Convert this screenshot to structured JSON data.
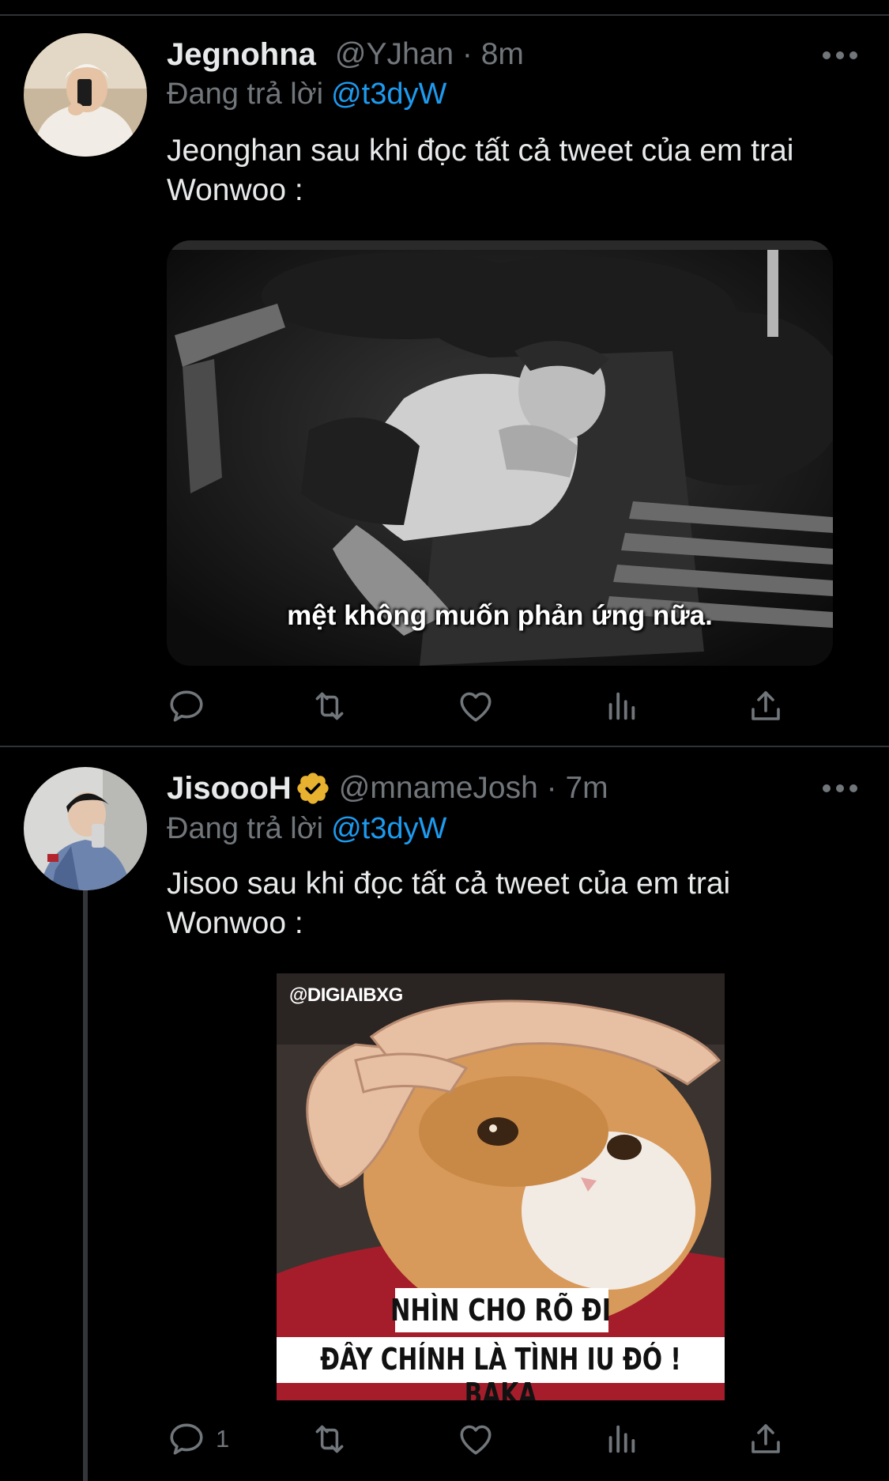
{
  "colors": {
    "background": "#000000",
    "text": "#e7e9ea",
    "secondary": "#71767b",
    "link": "#1d9bf0",
    "verified_badge": "#e8b12f",
    "divider": "#2f3336"
  },
  "tweets": [
    {
      "name": "Jegnohna",
      "handle": "@YJhan · 8m",
      "verified": false,
      "replying_label": "Đang trả lời",
      "replying_to": "@t3dyW",
      "text": "Jeonghan sau khi đọc tất cả tweet của em trai Wonwoo :",
      "media": {
        "caption": "mệt không muốn phản ứng nữa.",
        "icon": "sleeping-man-image"
      },
      "actions": [
        {
          "icon": "reply-icon",
          "count": ""
        },
        {
          "icon": "retweet-icon",
          "count": ""
        },
        {
          "icon": "like-icon",
          "count": ""
        },
        {
          "icon": "analytics-icon",
          "count": ""
        },
        {
          "icon": "share-icon",
          "count": ""
        }
      ]
    },
    {
      "name": "JisoooH",
      "handle": "@mnameJosh · 7m",
      "verified": true,
      "replying_label": "Đang trả lời",
      "replying_to": "@t3dyW",
      "text": "Jisoo sau khi đọc tất cả tweet của em trai Wonwoo :",
      "media": {
        "watermark": "@DIGIAIBXG",
        "caption_line1": "NHÌN CHO RÕ ĐI",
        "caption_line2": "ĐÂY CHÍNH LÀ TÌNH IU ĐÓ ! BAKA",
        "icon": "cat-meme-image"
      },
      "actions": [
        {
          "icon": "reply-icon",
          "count": "1"
        },
        {
          "icon": "retweet-icon",
          "count": ""
        },
        {
          "icon": "like-icon",
          "count": ""
        },
        {
          "icon": "analytics-icon",
          "count": ""
        },
        {
          "icon": "share-icon",
          "count": ""
        }
      ]
    }
  ]
}
